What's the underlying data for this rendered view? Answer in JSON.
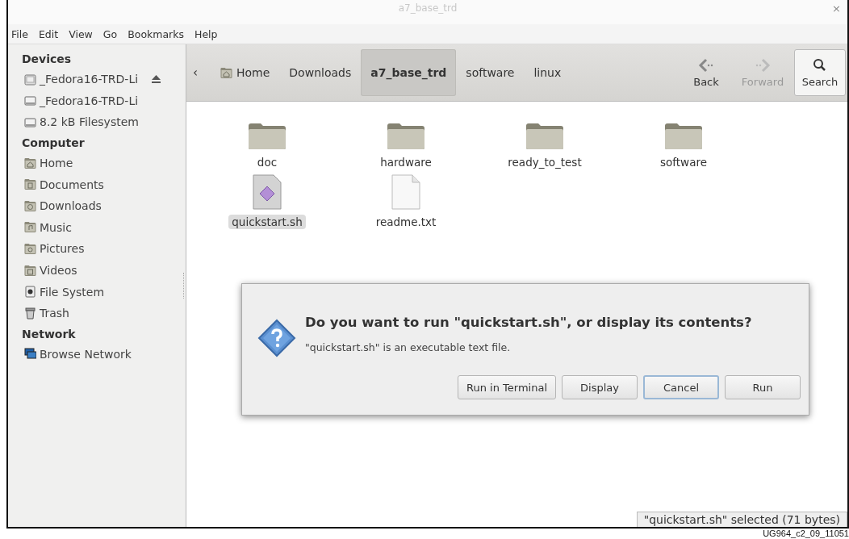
{
  "window": {
    "title": "a7_base_trd",
    "close": "×"
  },
  "menu": [
    "File",
    "Edit",
    "View",
    "Go",
    "Bookmarks",
    "Help"
  ],
  "sidebar": {
    "sections": [
      {
        "title": "Devices",
        "items": [
          {
            "label": "_Fedora16-TRD-Li",
            "kind": "disk",
            "ejectable": true
          },
          {
            "label": "_Fedora16-TRD-Li",
            "kind": "drive",
            "ejectable": false
          },
          {
            "label": "8.2 kB Filesystem",
            "kind": "drive",
            "ejectable": false
          }
        ]
      },
      {
        "title": "Computer",
        "items": [
          {
            "label": "Home",
            "kind": "home"
          },
          {
            "label": "Documents",
            "kind": "documents"
          },
          {
            "label": "Downloads",
            "kind": "downloads"
          },
          {
            "label": "Music",
            "kind": "music"
          },
          {
            "label": "Pictures",
            "kind": "pictures"
          },
          {
            "label": "Videos",
            "kind": "videos"
          },
          {
            "label": "File System",
            "kind": "filesystem"
          },
          {
            "label": "Trash",
            "kind": "trash"
          }
        ]
      },
      {
        "title": "Network",
        "items": [
          {
            "label": "Browse Network",
            "kind": "network"
          }
        ]
      }
    ]
  },
  "toolbar": {
    "back_arrow": "‹",
    "breadcrumbs": [
      {
        "label": "Home",
        "home": true,
        "selected": false
      },
      {
        "label": "Downloads",
        "home": false,
        "selected": false
      },
      {
        "label": "a7_base_trd",
        "home": false,
        "selected": true
      },
      {
        "label": "software",
        "home": false,
        "selected": false
      },
      {
        "label": "linux",
        "home": false,
        "selected": false
      }
    ],
    "buttons": [
      {
        "label": "Back",
        "kind": "back",
        "disabled": false
      },
      {
        "label": "Forward",
        "kind": "forward",
        "disabled": true
      },
      {
        "label": "Search",
        "kind": "search",
        "disabled": false
      }
    ]
  },
  "files": [
    {
      "name": "doc",
      "kind": "folder",
      "selected": false
    },
    {
      "name": "hardware",
      "kind": "folder",
      "selected": false
    },
    {
      "name": "ready_to_test",
      "kind": "folder",
      "selected": false
    },
    {
      "name": "software",
      "kind": "folder",
      "selected": false
    },
    {
      "name": "quickstart.sh",
      "kind": "script",
      "selected": true
    },
    {
      "name": "readme.txt",
      "kind": "text",
      "selected": false
    }
  ],
  "dialog": {
    "title": "Do you want to run \"quickstart.sh\", or display its contents?",
    "message": "\"quickstart.sh\" is an executable text file.",
    "buttons": [
      {
        "label": "Run in Terminal",
        "focused": false
      },
      {
        "label": "Display",
        "focused": false
      },
      {
        "label": "Cancel",
        "focused": true
      },
      {
        "label": "Run",
        "focused": false
      }
    ]
  },
  "status_bar": "\"quickstart.sh\" selected (71 bytes)",
  "caption": "UG964_c2_09_11051"
}
